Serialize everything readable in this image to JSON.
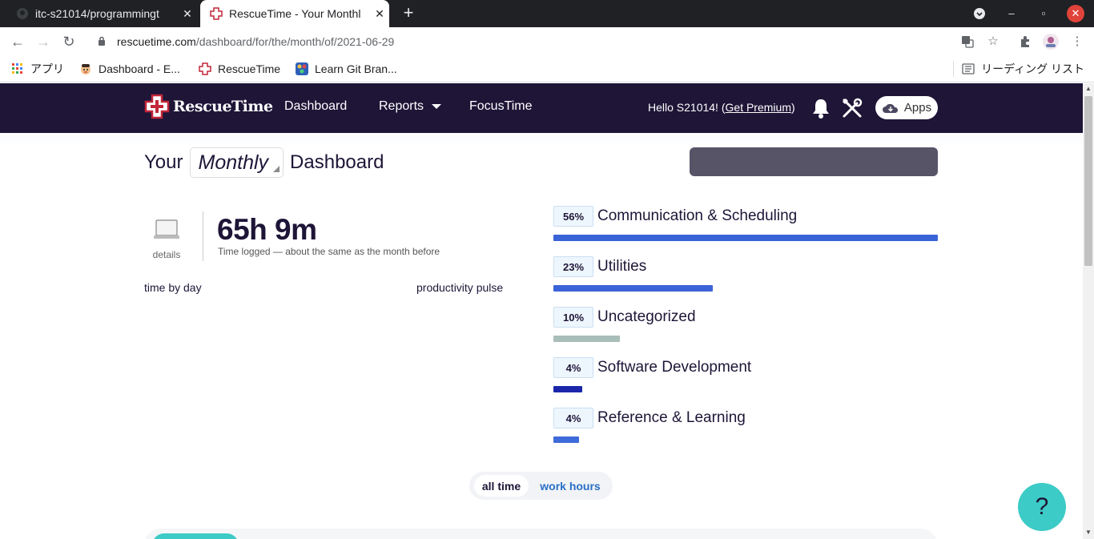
{
  "browser": {
    "tabs": [
      {
        "title": "itc-s21014/programmingt",
        "favicon": "github-icon",
        "active": false
      },
      {
        "title": "RescueTime - Your Monthl",
        "favicon": "rescuetime-icon",
        "active": true
      }
    ],
    "url_host": "rescuetime.com",
    "url_path": "/dashboard/for/the/month/of/2021-06-29",
    "bookmarks": [
      {
        "label": "アプリ",
        "icon": "apps-grid-icon"
      },
      {
        "label": "Dashboard - E...",
        "icon": "avatar-icon"
      },
      {
        "label": "RescueTime",
        "icon": "rescuetime-icon"
      },
      {
        "label": "Learn Git Bran...",
        "icon": "git-branch-icon"
      }
    ],
    "reading_list": "リーディング リスト"
  },
  "nav": {
    "brand": "RescueTime",
    "links": [
      "Dashboard",
      "Reports",
      "FocusTime"
    ],
    "hello": "Hello S21014! (",
    "premium": "Get Premium",
    "hello_end": ")",
    "apps": "Apps"
  },
  "dashboard": {
    "title_prefix": "Your",
    "period": "Monthly",
    "title_suffix": "Dashboard",
    "details_label": "details",
    "time_logged": "65h 9m",
    "time_sub": "Time logged — about the same as the month before",
    "time_by_day": "time by day",
    "productivity_pulse": "productivity pulse",
    "categories": [
      {
        "pct": "56%",
        "name": "Communication & Scheduling",
        "share": 1.0,
        "color": "#3b63d8"
      },
      {
        "pct": "23%",
        "name": "Utilities",
        "share": 0.415,
        "color": "#3b63d8"
      },
      {
        "pct": "10%",
        "name": "Uncategorized",
        "share": 0.173,
        "color": "#a9bdb9"
      },
      {
        "pct": "4%",
        "name": "Software Development",
        "share": 0.075,
        "color": "#1b27a8"
      },
      {
        "pct": "4%",
        "name": "Reference & Learning",
        "share": 0.067,
        "color": "#3f6ad9"
      }
    ],
    "toggle": {
      "on": "all time",
      "off": "work hours"
    },
    "help": "?"
  }
}
